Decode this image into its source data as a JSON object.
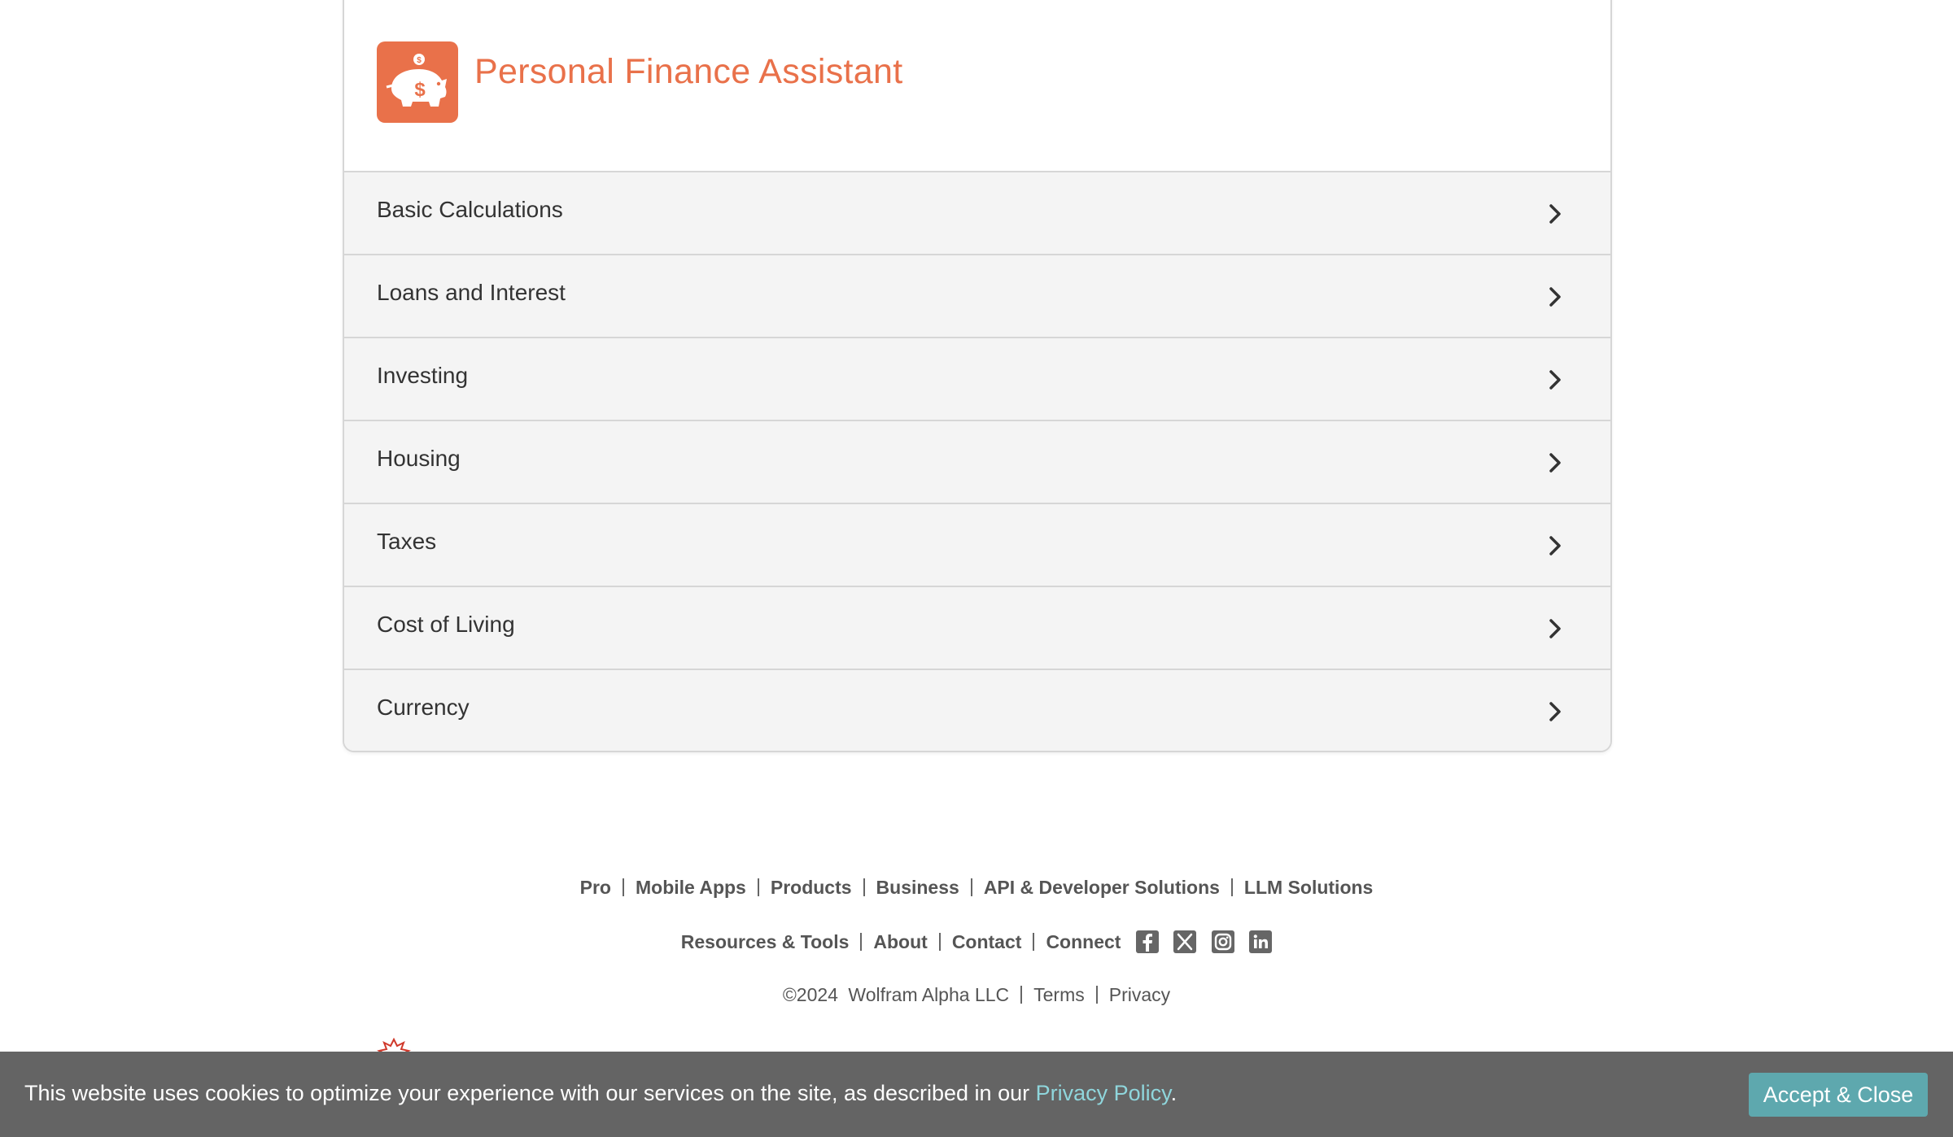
{
  "app": {
    "title": "Personal Finance Assistant",
    "icon": "piggy-bank-icon",
    "accent_color": "#e9714a"
  },
  "menu": {
    "items": [
      {
        "label": "Basic Calculations"
      },
      {
        "label": "Loans and Interest"
      },
      {
        "label": "Investing"
      },
      {
        "label": "Housing"
      },
      {
        "label": "Taxes"
      },
      {
        "label": "Cost of Living"
      },
      {
        "label": "Currency"
      }
    ]
  },
  "footer": {
    "row1": [
      "Pro",
      "Mobile Apps",
      "Products",
      "Business",
      "API & Developer Solutions",
      "LLM Solutions"
    ],
    "row2": [
      "Resources & Tools",
      "About",
      "Contact",
      "Connect"
    ],
    "social_icons": [
      "facebook-icon",
      "x-twitter-icon",
      "instagram-icon",
      "linkedin-icon"
    ],
    "copyright": "©2024",
    "company": "Wolfram Alpha LLC",
    "terms": "Terms",
    "privacy": "Privacy"
  },
  "cookie_bar": {
    "text": "This website uses cookies to optimize your experience with our services on the site, as described in our",
    "link": "Privacy Policy",
    "period": ".",
    "button": "Accept & Close",
    "link_color": "#8fd6dc",
    "button_color": "#5ea8ae"
  }
}
